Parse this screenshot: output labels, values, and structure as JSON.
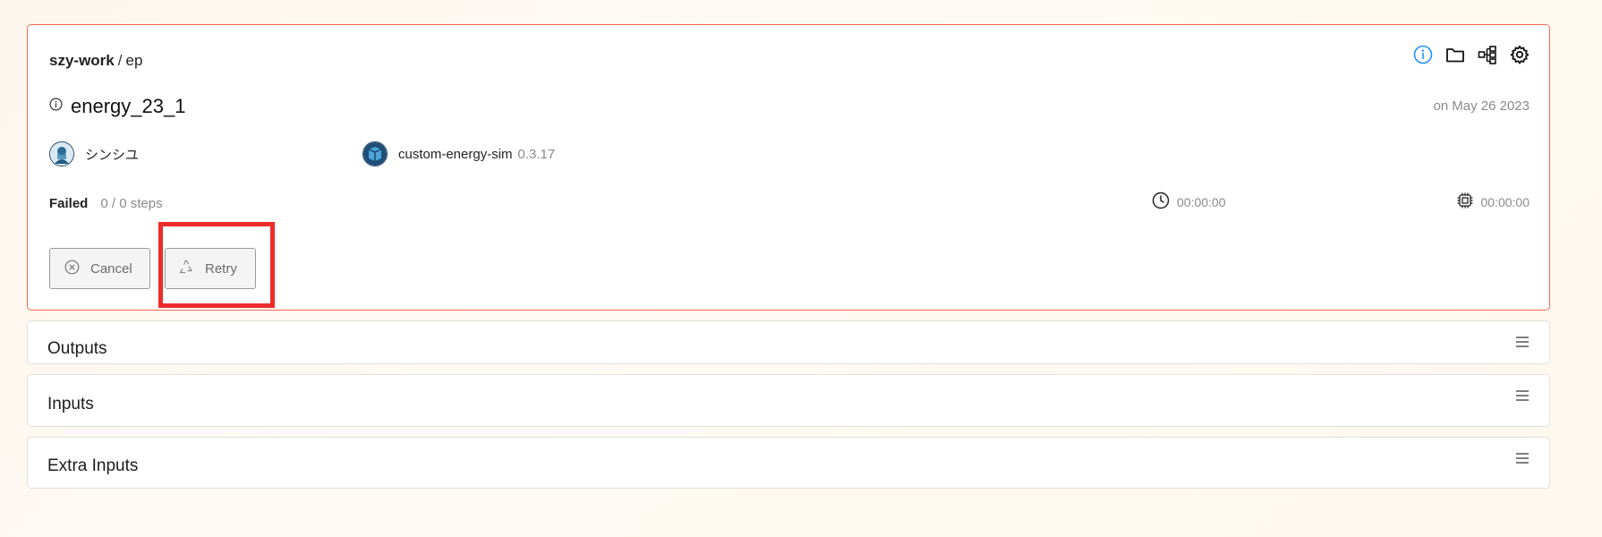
{
  "breadcrumb": {
    "owner": "szy-work",
    "separator": "/",
    "project": "ep"
  },
  "header_icons": [
    "info-icon",
    "folder-icon",
    "workflow-icon",
    "gear-icon"
  ],
  "job": {
    "title": "energy_23_1",
    "date_prefix": "on",
    "date": "May 26 2023",
    "user_name": "シンシユ",
    "app_name": "custom-energy-sim",
    "app_version": "0.3.17",
    "status": "Failed",
    "steps": "0 / 0 steps",
    "wall_time": "00:00:00",
    "cpu_time": "00:00:00"
  },
  "actions": {
    "cancel_label": "Cancel",
    "retry_label": "Retry"
  },
  "sections": {
    "outputs": "Outputs",
    "inputs": "Inputs",
    "extra_inputs": "Extra Inputs"
  },
  "colors": {
    "card_border": "#f06a4f",
    "highlight": "#ee2b2b",
    "info_blue": "#1e90ff"
  }
}
